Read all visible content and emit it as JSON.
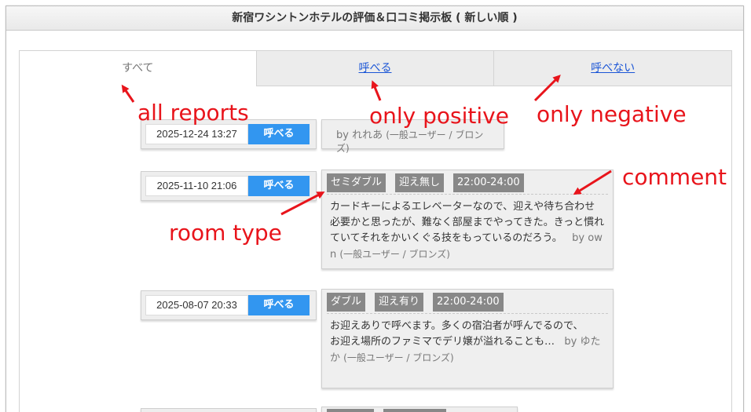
{
  "window": {
    "title": "新宿ワシントンホテルの評価＆口コミ掲示板 ( 新しい順 )"
  },
  "tabs": [
    {
      "label": "すべて"
    },
    {
      "label": "呼べる"
    },
    {
      "label": "呼べない"
    }
  ],
  "entries": [
    {
      "date": "2025-12-24 13:27",
      "status": "呼べる",
      "tags": [],
      "text": "",
      "by": "by れれあ",
      "role": "(一般ユーザー / ブロンズ)"
    },
    {
      "date": "2025-11-10 21:06",
      "status": "呼べる",
      "tags": [
        "セミダブル",
        "迎え無し",
        "22:00-24:00"
      ],
      "text": "カードキーによるエレベーターなので、迎えや待ち合わせ必要かと思ったが、難なく部屋までやってきた。きっと慣れていてそれをかいくぐる技をもっているのだろう。",
      "by": "by own",
      "role": "(一般ユーザー / ブロンズ)"
    },
    {
      "date": "2025-08-07 20:33",
      "status": "呼べる",
      "tags": [
        "ダブル",
        "迎え有り",
        "22:00-24:00"
      ],
      "text_line1": "お迎えありで呼べます。多くの宿泊者が呼んでるので、",
      "text_line2": "お迎え場所のファミマでデリ嬢が溢れることも…",
      "by": "by ゆたか",
      "role": "(一般ユーザー / ブロンズ)"
    }
  ],
  "annotations": {
    "all_reports": "all reports",
    "only_positive": "only positive",
    "only_negative": "only negative",
    "comment": "comment",
    "room_type": "room type"
  },
  "colors": {
    "accent_button": "#3296f0",
    "tag_bg": "#888888",
    "annotation": "#e8141b",
    "link": "#1a55d6"
  }
}
